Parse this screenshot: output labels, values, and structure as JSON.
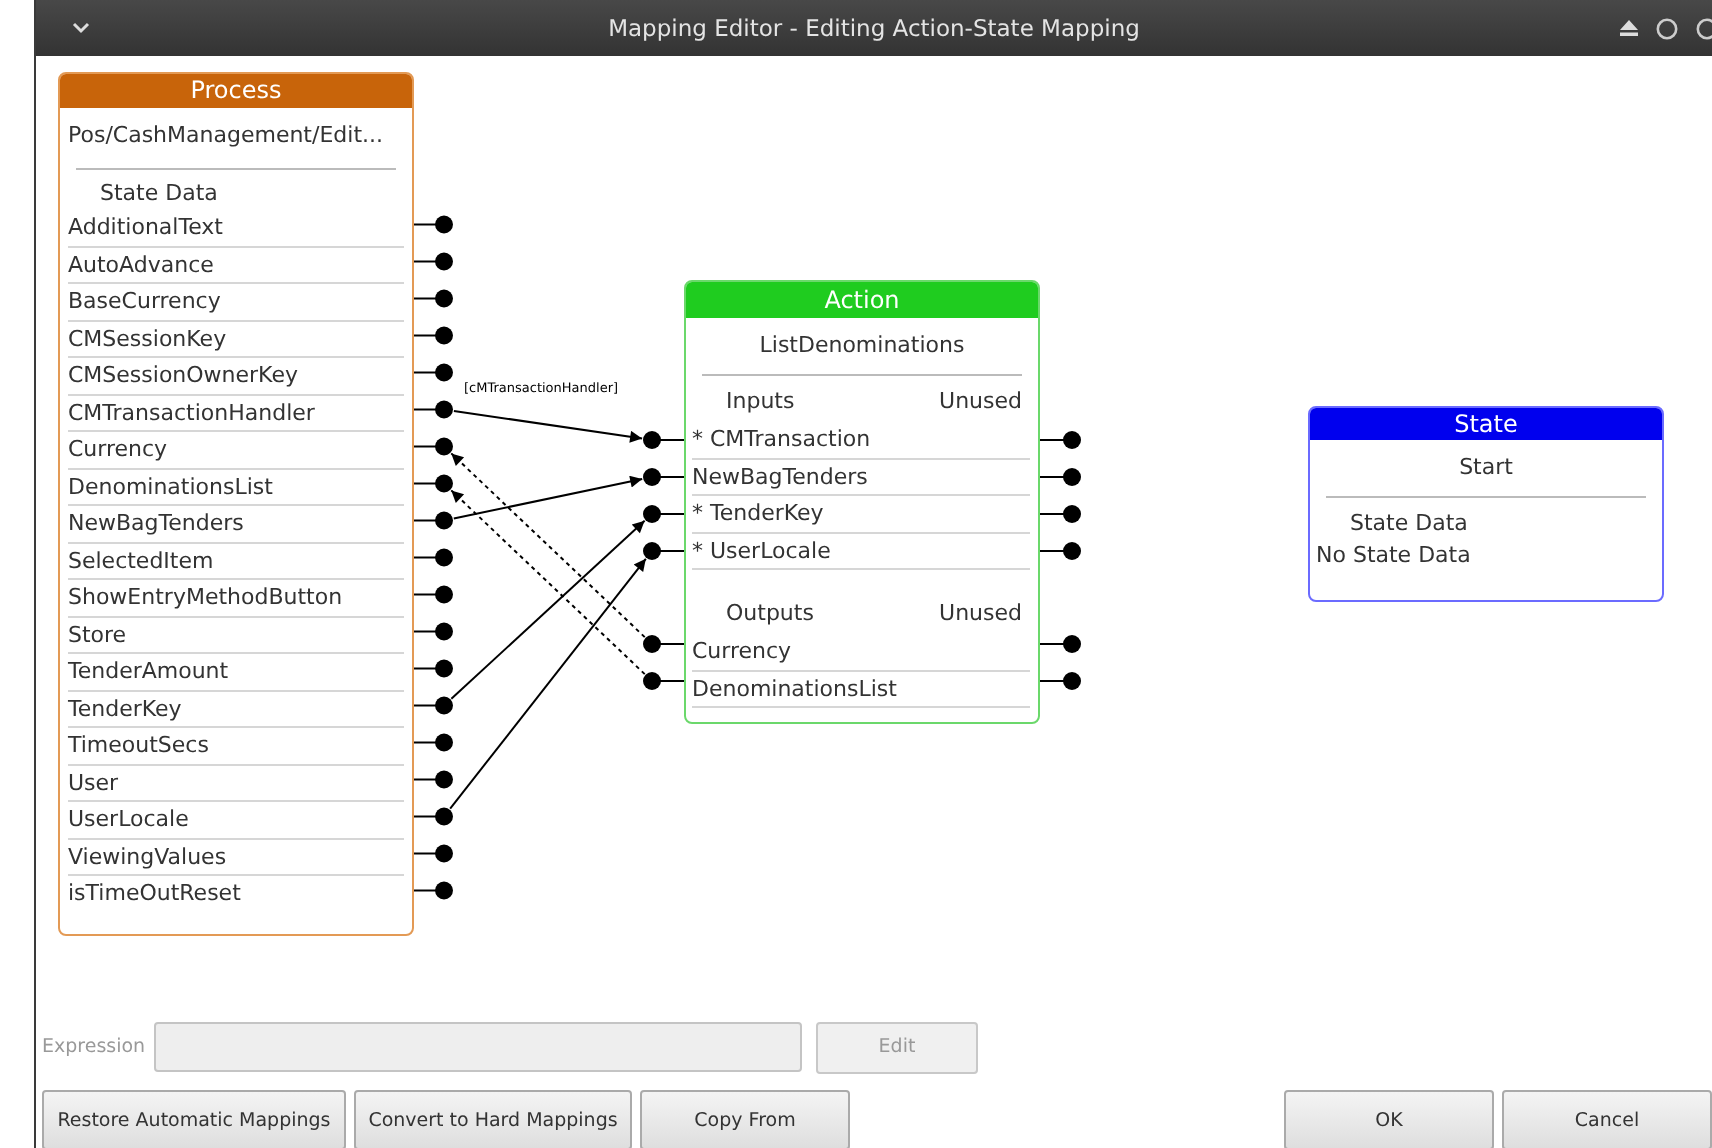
{
  "window": {
    "title": "Mapping Editor - Editing Action-State Mapping"
  },
  "process": {
    "header": "Process",
    "name": "Pos/CashManagement/Edit...",
    "section": "State Data",
    "fields": [
      {
        "label": "AdditionalText"
      },
      {
        "label": "AutoAdvance"
      },
      {
        "label": "BaseCurrency"
      },
      {
        "label": "CMSessionKey"
      },
      {
        "label": "CMSessionOwnerKey"
      },
      {
        "label": "CMTransactionHandler",
        "mapping_label": "[cMTransactionHandler]"
      },
      {
        "label": "Currency"
      },
      {
        "label": "DenominationsList"
      },
      {
        "label": "NewBagTenders"
      },
      {
        "label": "SelectedItem"
      },
      {
        "label": "ShowEntryMethodButton"
      },
      {
        "label": "Store"
      },
      {
        "label": "TenderAmount"
      },
      {
        "label": "TenderKey"
      },
      {
        "label": "TimeoutSecs"
      },
      {
        "label": "User"
      },
      {
        "label": "UserLocale"
      },
      {
        "label": "ViewingValues"
      },
      {
        "label": "isTimeOutReset"
      }
    ]
  },
  "action": {
    "header": "Action",
    "name": "ListDenominations",
    "inputs": {
      "label": "Inputs",
      "unused": "Unused",
      "items": [
        {
          "label": "* CMTransaction"
        },
        {
          "label": "NewBagTenders"
        },
        {
          "label": "* TenderKey"
        },
        {
          "label": "* UserLocale"
        }
      ]
    },
    "outputs": {
      "label": "Outputs",
      "unused": "Unused",
      "items": [
        {
          "label": "Currency"
        },
        {
          "label": "DenominationsList"
        }
      ]
    }
  },
  "state": {
    "header": "State",
    "name": "Start",
    "section": "State Data",
    "note": "No State Data"
  },
  "expression": {
    "label": "Expression",
    "disabled": true,
    "edit": "Edit"
  },
  "buttons": [
    {
      "label": "Restore Automatic Mappings"
    },
    {
      "label": "Convert to Hard Mappings"
    },
    {
      "label": "Copy From"
    }
  ],
  "dialog_buttons": [
    {
      "label": "OK"
    },
    {
      "label": "Cancel"
    }
  ]
}
